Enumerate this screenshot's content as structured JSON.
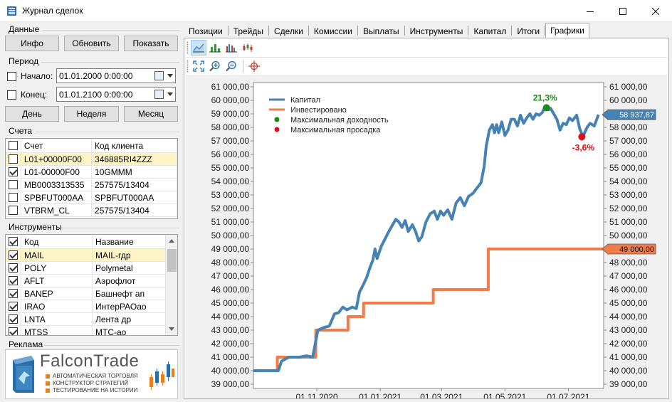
{
  "window": {
    "title": "Журнал сделок"
  },
  "left": {
    "data_section": "Данные",
    "buttons": {
      "info": "Инфо",
      "refresh": "Обновить",
      "show": "Показать"
    },
    "period_section": "Период",
    "start": {
      "label": "Начало:",
      "value": "01.01.2000   0:00:00",
      "checked": false
    },
    "end": {
      "label": "Конец:",
      "value": "01.01.2100   0:00:00",
      "checked": false
    },
    "period_buttons": {
      "day": "День",
      "week": "Неделя",
      "month": "Месяц"
    },
    "accounts_section": "Счета",
    "accounts": {
      "headers": [
        "Счет",
        "Код клиента"
      ],
      "rows": [
        {
          "account": "L01+00000F00",
          "client": "346885RI4ZZZ",
          "checked": false,
          "selected": true
        },
        {
          "account": "L01-00000F00",
          "client": "10GMMM",
          "checked": true,
          "selected": false
        },
        {
          "account": "MB0003313535",
          "client": "257575/13404",
          "checked": false,
          "selected": false
        },
        {
          "account": "SPBFUT000AA",
          "client": "SPBFUT000AA",
          "checked": false,
          "selected": false
        },
        {
          "account": "VTBRM_CL",
          "client": "257575/13404",
          "checked": false,
          "selected": false
        }
      ]
    },
    "instruments_section": "Инструменты",
    "instruments": {
      "headers": [
        "Код",
        "Название"
      ],
      "rows": [
        {
          "code": "MAIL",
          "name": "MAIL-гдр",
          "checked": true,
          "selected": true
        },
        {
          "code": "POLY",
          "name": "Polymetal",
          "checked": true,
          "selected": false
        },
        {
          "code": "AFLT",
          "name": "Аэрофлот",
          "checked": true,
          "selected": false
        },
        {
          "code": "BANEP",
          "name": "Башнефт ап",
          "checked": true,
          "selected": false
        },
        {
          "code": "IRAO",
          "name": "ИнтерРАОао",
          "checked": true,
          "selected": false
        },
        {
          "code": "LNTA",
          "name": "Лента др",
          "checked": true,
          "selected": false
        },
        {
          "code": "MTSS",
          "name": "МТС-ао",
          "checked": true,
          "selected": false
        }
      ]
    },
    "ad_section": "Реклама",
    "ad": {
      "brand": "FalconTrade",
      "lines": [
        "АВТОМАТИЧЕСКАЯ ТОРГОВЛЯ",
        "КОНСТРУКТОР СТРАТЕГИЙ",
        "ТЕСТИРОВАНИЕ НА ИСТОРИИ"
      ]
    }
  },
  "tabs": [
    "Позиции",
    "Трейды",
    "Сделки",
    "Комиссии",
    "Выплаты",
    "Инструменты",
    "Капитал",
    "Итоги",
    "Графики"
  ],
  "active_tab": "Графики",
  "colors": {
    "capital": "#4682b4",
    "invested": "#f07c4a",
    "max_profit": "#1a8a1a",
    "max_drawdown": "#e0101a"
  },
  "chart_data": {
    "type": "line",
    "legend": [
      "Капитал",
      "Инвестировано",
      "Максимальная доходность",
      "Максимальная просадка"
    ],
    "legend_placement": "top-left",
    "xlabel": "",
    "ylabel": "",
    "x_ticks": [
      "01.11.2020",
      "01.01.2021",
      "01.03.2021",
      "01.05.2021",
      "01.07.2021"
    ],
    "y_ticks": [
      "39 000,00",
      "40 000,00",
      "41 000,00",
      "42 000,00",
      "43 000,00",
      "44 000,00",
      "45 000,00",
      "46 000,00",
      "47 000,00",
      "48 000,00",
      "49 000,00",
      "50 000,00",
      "51 000,00",
      "52 000,00",
      "53 000,00",
      "54 000,00",
      "55 000,00",
      "56 000,00",
      "57 000,00",
      "58 000,00",
      "59 000,00",
      "60 000,00",
      "61 000,00"
    ],
    "ylim": [
      39000,
      61000
    ],
    "xlim": [
      "2020-09-01",
      "2021-08-04"
    ],
    "series": [
      {
        "name": "Капитал",
        "points": [
          [
            "2020-09-01",
            40000
          ],
          [
            "2020-09-25",
            40000
          ],
          [
            "2020-09-28",
            40700
          ],
          [
            "2020-10-05",
            41000
          ],
          [
            "2020-10-15",
            41000
          ],
          [
            "2020-10-22",
            41100
          ],
          [
            "2020-10-28",
            41000
          ],
          [
            "2020-11-02",
            43000
          ],
          [
            "2020-11-08",
            43200
          ],
          [
            "2020-11-13",
            43300
          ],
          [
            "2020-11-18",
            44200
          ],
          [
            "2020-11-22",
            44300
          ],
          [
            "2020-11-26",
            44700
          ],
          [
            "2020-11-30",
            44500
          ],
          [
            "2020-12-05",
            44700
          ],
          [
            "2020-12-09",
            44600
          ],
          [
            "2020-12-12",
            45800
          ],
          [
            "2020-12-16",
            46400
          ],
          [
            "2020-12-19",
            46900
          ],
          [
            "2020-12-22",
            47600
          ],
          [
            "2020-12-25",
            48200
          ],
          [
            "2020-12-27",
            49000
          ],
          [
            "2020-12-29",
            48300
          ],
          [
            "2021-01-02",
            49200
          ],
          [
            "2021-01-06",
            49800
          ],
          [
            "2021-01-10",
            50400
          ],
          [
            "2021-01-13",
            50800
          ],
          [
            "2021-01-16",
            51200
          ],
          [
            "2021-01-19",
            51000
          ],
          [
            "2021-01-22",
            50600
          ],
          [
            "2021-01-25",
            51100
          ],
          [
            "2021-01-28",
            50300
          ],
          [
            "2021-02-01",
            50800
          ],
          [
            "2021-02-04",
            50300
          ],
          [
            "2021-02-07",
            49600
          ],
          [
            "2021-02-10",
            49900
          ],
          [
            "2021-02-14",
            51000
          ],
          [
            "2021-02-18",
            51600
          ],
          [
            "2021-02-22",
            51800
          ],
          [
            "2021-02-25",
            51200
          ],
          [
            "2021-02-28",
            51800
          ],
          [
            "2021-03-03",
            51500
          ],
          [
            "2021-03-07",
            51900
          ],
          [
            "2021-03-11",
            51200
          ],
          [
            "2021-03-15",
            52400
          ],
          [
            "2021-03-19",
            52800
          ],
          [
            "2021-03-23",
            52200
          ],
          [
            "2021-03-27",
            52900
          ],
          [
            "2021-03-31",
            53100
          ],
          [
            "2021-04-04",
            53500
          ],
          [
            "2021-04-08",
            53900
          ],
          [
            "2021-04-11",
            55100
          ],
          [
            "2021-04-13",
            56600
          ],
          [
            "2021-04-16",
            57800
          ],
          [
            "2021-04-19",
            58200
          ],
          [
            "2021-04-21",
            57600
          ],
          [
            "2021-04-23",
            58200
          ],
          [
            "2021-04-25",
            57600
          ],
          [
            "2021-04-28",
            58400
          ],
          [
            "2021-05-01",
            57400
          ],
          [
            "2021-05-04",
            57800
          ],
          [
            "2021-05-07",
            58600
          ],
          [
            "2021-05-10",
            58600
          ],
          [
            "2021-05-13",
            58100
          ],
          [
            "2021-05-16",
            58900
          ],
          [
            "2021-05-19",
            58300
          ],
          [
            "2021-05-22",
            58700
          ],
          [
            "2021-05-25",
            59000
          ],
          [
            "2021-05-28",
            58600
          ],
          [
            "2021-05-31",
            59000
          ],
          [
            "2021-06-03",
            58900
          ],
          [
            "2021-06-06",
            59100
          ],
          [
            "2021-06-09",
            59600
          ],
          [
            "2021-06-12",
            59300
          ],
          [
            "2021-06-14",
            59400
          ],
          [
            "2021-06-17",
            59000
          ],
          [
            "2021-06-20",
            58600
          ],
          [
            "2021-06-23",
            57800
          ],
          [
            "2021-06-26",
            58300
          ],
          [
            "2021-06-29",
            58200
          ],
          [
            "2021-07-02",
            58700
          ],
          [
            "2021-07-05",
            58500
          ],
          [
            "2021-07-09",
            58900
          ],
          [
            "2021-07-12",
            57900
          ],
          [
            "2021-07-15",
            57300
          ],
          [
            "2021-07-19",
            58000
          ],
          [
            "2021-07-22",
            58300
          ],
          [
            "2021-07-26",
            58100
          ],
          [
            "2021-07-30",
            58937.87
          ]
        ]
      },
      {
        "name": "Инвестировано",
        "points": [
          [
            "2020-09-01",
            40000
          ],
          [
            "2020-09-24",
            40000
          ],
          [
            "2020-09-24",
            41000
          ],
          [
            "2020-10-31",
            41000
          ],
          [
            "2020-10-31",
            43000
          ],
          [
            "2020-12-01",
            43000
          ],
          [
            "2020-12-01",
            44000
          ],
          [
            "2020-12-16",
            44000
          ],
          [
            "2020-12-16",
            45000
          ],
          [
            "2021-02-21",
            45000
          ],
          [
            "2021-02-21",
            46000
          ],
          [
            "2021-04-15",
            46000
          ],
          [
            "2021-04-15",
            49000
          ],
          [
            "2021-08-04",
            49000
          ]
        ]
      }
    ],
    "annotations": {
      "max_profit": {
        "label": "21,3%",
        "x": "2021-06-10",
        "y": 59450
      },
      "max_drawdown": {
        "label": "-3,6%",
        "x": "2021-07-14",
        "y": 57300
      }
    },
    "value_tags": {
      "capital": "58 937,87",
      "invested": "49 000,00"
    }
  }
}
